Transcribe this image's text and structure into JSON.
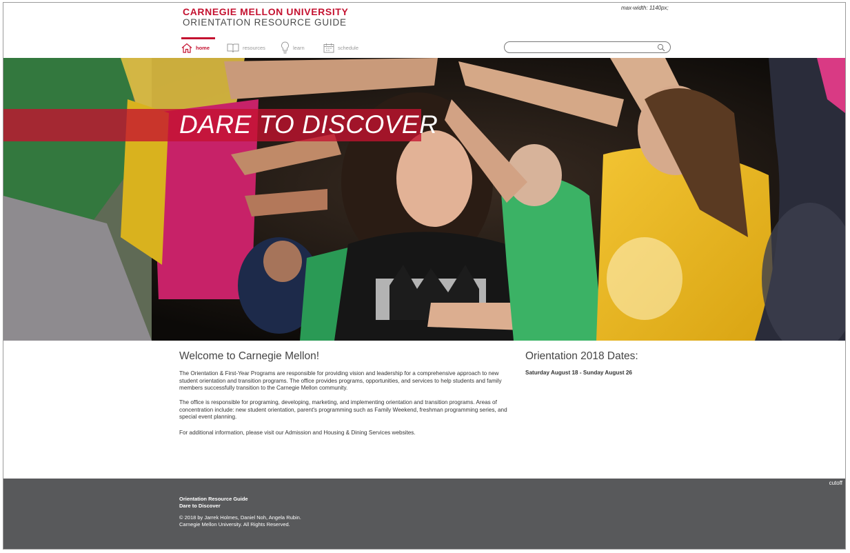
{
  "header": {
    "university": "CARNEGIE MELLON UNIVERSITY",
    "subtitle": "ORIENTATION RESOURCE GUIDE",
    "note": "max-width: 1140px;"
  },
  "nav": {
    "items": [
      {
        "label": "home",
        "icon": "home-icon",
        "active": true
      },
      {
        "label": "resources",
        "icon": "book-icon",
        "active": false
      },
      {
        "label": "learn",
        "icon": "lightbulb-icon",
        "active": false
      },
      {
        "label": "schedule",
        "icon": "calendar-icon",
        "active": false
      }
    ]
  },
  "search": {
    "placeholder": "",
    "icon": "search-icon"
  },
  "hero": {
    "headline": "DARE TO DISCOVER"
  },
  "welcome": {
    "heading": "Welcome to Carnegie Mellon!",
    "p1": "The Orientation & First-Year Programs are responsible for providing vision and leadership for a comprehensive approach to new student orientation and transition programs. The office provides programs, opportunities, and services to help students and family members successfully transition to the Carnegie Mellon community.",
    "p2": "The office is responsible for programing, developing, marketing, and implementing orientation and transition programs. Areas of concentration include: new student orientation, parent's programming such as Family Weekend, freshman programming series, and special event planning.",
    "p3": "For additional information, please visit our Admission and Housing & Dining Services websites."
  },
  "dates": {
    "heading": "Orientation 2018 Dates:",
    "range": "Saturday August 18 - Sunday August 26"
  },
  "footer": {
    "cutoff": "cutoff",
    "line1": "Orientation Resource Guide",
    "line2": "Dare to Discover",
    "copyright": "© 2018 by Jarrek Holmes, Daniel Noh, Angela Rubin.",
    "rights": "Carnegie Mellon University. All Rights Reserved."
  },
  "colors": {
    "brand_red": "#c41230",
    "footer_gray": "#58595b"
  }
}
